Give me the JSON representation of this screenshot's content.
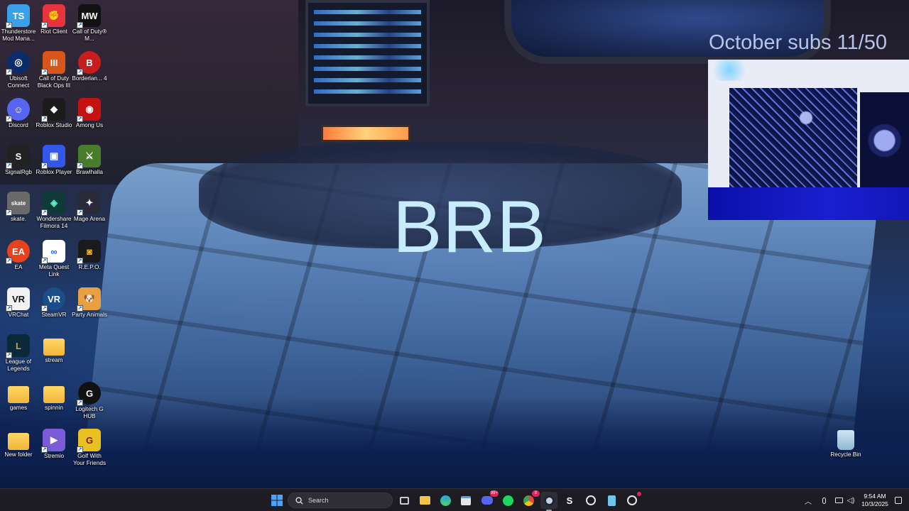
{
  "overlay": {
    "brb_text": "BRB",
    "subs_text": "October subs 11/50"
  },
  "desktop_icons": [
    {
      "label": "Thunderstore Mod Mana...",
      "icon": "thunderstore-icon",
      "color": "#3aa0e8"
    },
    {
      "label": "Riot Client",
      "icon": "riot-client-icon",
      "color": "#e8343c"
    },
    {
      "label": "Call of Duty® M...",
      "icon": "call-of-duty-mw-icon",
      "color": "#111111"
    },
    {
      "label": "Ubisoft Connect",
      "icon": "ubisoft-connect-icon",
      "color": "#0b2c6b"
    },
    {
      "label": "Call of Duty Black Ops III",
      "icon": "black-ops-iii-icon",
      "color": "#d8561c"
    },
    {
      "label": "Borderlan... 4",
      "icon": "borderlands-icon",
      "color": "#c81d1d"
    },
    {
      "label": "Discord",
      "icon": "discord-icon",
      "color": "#5865f2"
    },
    {
      "label": "Roblox Studio",
      "icon": "roblox-studio-icon",
      "color": "#1b1b1b"
    },
    {
      "label": "Among Us",
      "icon": "among-us-icon",
      "color": "#c51111"
    },
    {
      "label": "SignalRgb",
      "icon": "signalrgb-icon",
      "color": "#222222"
    },
    {
      "label": "Roblox Player",
      "icon": "roblox-player-icon",
      "color": "#3357e8"
    },
    {
      "label": "Brawlhalla",
      "icon": "brawlhalla-icon",
      "color": "#4a7d2b"
    },
    {
      "label": "skate.",
      "icon": "skate-icon",
      "color": "#6a6a6a"
    },
    {
      "label": "Wondershare Filmora 14",
      "icon": "filmora-icon",
      "color": "#0e3b3a"
    },
    {
      "label": "Mage Arena",
      "icon": "mage-arena-icon",
      "color": "#2a2a3a"
    },
    {
      "label": "EA",
      "icon": "ea-icon",
      "color": "#e8421c"
    },
    {
      "label": "Meta Quest Link",
      "icon": "meta-quest-link-icon",
      "color": "#ffffff"
    },
    {
      "label": "R.E.P.O.",
      "icon": "repo-icon",
      "color": "#1a1a1a"
    },
    {
      "label": "VRChat",
      "icon": "vrchat-icon",
      "color": "#f2f2f2"
    },
    {
      "label": "SteamVR",
      "icon": "steamvr-icon",
      "color": "#1b4d8a"
    },
    {
      "label": "Party Animals",
      "icon": "party-animals-icon",
      "color": "#e8a040"
    },
    {
      "label": "League of Legends",
      "icon": "league-of-legends-icon",
      "color": "#0a2a3a"
    },
    {
      "label": "stream",
      "icon": "folder-icon",
      "color": "#f5c443"
    },
    {
      "label": "games",
      "icon": "folder-icon",
      "color": "#f5c443"
    },
    {
      "label": "spinnin",
      "icon": "folder-icon",
      "color": "#f5c443"
    },
    {
      "label": "Logitech G HUB",
      "icon": "logitech-g-hub-icon",
      "color": "#111111"
    },
    {
      "label": "New folder",
      "icon": "folder-icon",
      "color": "#f5c443"
    },
    {
      "label": "Stremio",
      "icon": "stremio-icon",
      "color": "#7b5bd6"
    },
    {
      "label": "Golf With Your Friends",
      "icon": "golf-with-your-friends-icon",
      "color": "#e8c020"
    },
    {
      "label": "Recycle Bin",
      "icon": "recycle-bin-icon",
      "color": "#9cc3de"
    }
  ],
  "taskbar": {
    "search_placeholder": "Search",
    "apps": [
      {
        "name": "start",
        "icon": "windows-start-icon",
        "color": "#4aa3ff"
      },
      {
        "name": "task-view",
        "icon": "task-view-icon",
        "color": "#c9c9d2"
      },
      {
        "name": "file-explorer",
        "icon": "file-explorer-icon",
        "color": "#f5c443"
      },
      {
        "name": "edge",
        "icon": "edge-icon",
        "color": "#2fa3d8"
      },
      {
        "name": "microsoft-store",
        "icon": "store-icon",
        "color": "#e6e6e6"
      },
      {
        "name": "discord",
        "icon": "discord-icon",
        "color": "#5865f2",
        "badge": "99+"
      },
      {
        "name": "spotify",
        "icon": "spotify-icon",
        "color": "#1ed760"
      },
      {
        "name": "chrome",
        "icon": "chrome-icon",
        "color": "#e8453c",
        "badge": "8"
      },
      {
        "name": "steam",
        "icon": "steam-icon",
        "color": "#c7d5e0"
      },
      {
        "name": "signalrgb",
        "icon": "signalrgb-icon",
        "color": "#ffffff"
      },
      {
        "name": "obs",
        "icon": "obs-icon",
        "color": "#e6e6e6"
      },
      {
        "name": "notepad",
        "icon": "notepad-icon",
        "color": "#6ec6e8"
      },
      {
        "name": "app-alert",
        "icon": "app-alert-icon",
        "color": "#e6e6e6"
      }
    ],
    "tray": {
      "time": "9:54 AM",
      "date": "10/3/2025"
    }
  }
}
